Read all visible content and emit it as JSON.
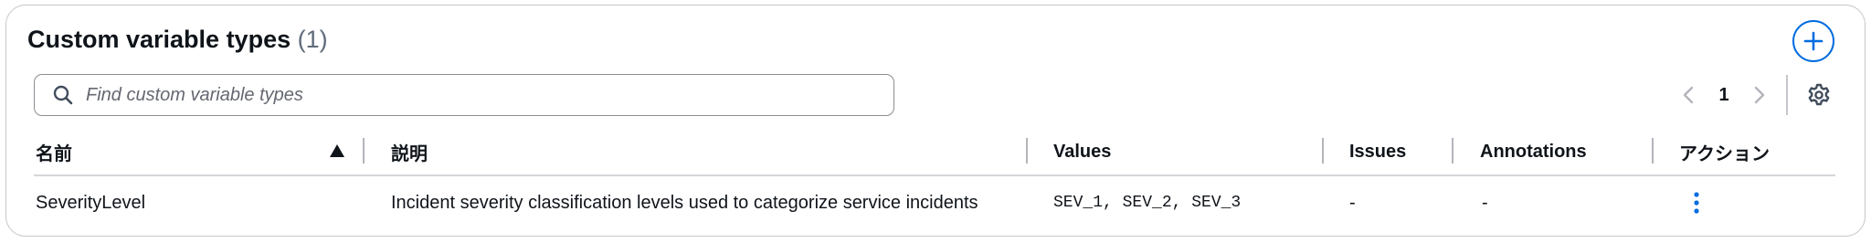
{
  "header": {
    "title": "Custom variable types",
    "count": "(1)",
    "add_button_icon": "plus-icon"
  },
  "search": {
    "placeholder": "Find custom variable types",
    "value": "",
    "icon": "search-icon"
  },
  "pagination": {
    "current_page": "1",
    "prev_icon": "chevron-left-icon",
    "next_icon": "chevron-right-icon",
    "settings_icon": "gear-icon"
  },
  "table": {
    "columns": [
      "名前",
      "説明",
      "Values",
      "Issues",
      "Annotations",
      "アクション"
    ],
    "sort": {
      "column": "名前",
      "direction": "ascending"
    },
    "rows": [
      {
        "name": "SeverityLevel",
        "description": "Incident severity classification levels used to categorize service incidents",
        "values": "SEV_1, SEV_2, SEV_3",
        "issues": "-",
        "annotations": "-",
        "action_icon": "more-vertical-icon"
      }
    ]
  },
  "colors": {
    "accent": "#006ce0",
    "text": "#0f141a",
    "muted_text": "#5f6b7a",
    "border": "#c6c6cd"
  }
}
